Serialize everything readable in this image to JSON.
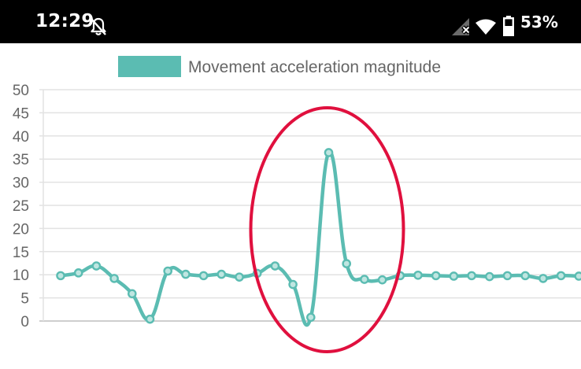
{
  "status_bar": {
    "time": "12:29",
    "battery": "53%",
    "icons": [
      "notifications-off-icon",
      "cellular-no-data-icon",
      "wifi-icon",
      "battery-icon"
    ]
  },
  "chart_data": {
    "type": "line",
    "title": "",
    "xlabel": "",
    "ylabel": "",
    "ylim": [
      0,
      50
    ],
    "y_ticks": [
      "0",
      "5",
      "10",
      "15",
      "20",
      "25",
      "30",
      "35",
      "40",
      "45",
      "50"
    ],
    "grid": true,
    "legend_position": "top",
    "series": [
      {
        "name": "Movement acceleration magnitude",
        "color": "#5bbcb2",
        "values": [
          9.8,
          10.4,
          11.9,
          9.2,
          5.9,
          0.4,
          10.8,
          10.1,
          9.8,
          10.1,
          9.5,
          10.3,
          11.9,
          7.9,
          0.8,
          36.4,
          12.4,
          9.0,
          8.9,
          9.8,
          9.9,
          9.8,
          9.7,
          9.8,
          9.6,
          9.8,
          9.8,
          9.2,
          9.8,
          9.7
        ]
      }
    ],
    "annotation": {
      "shape": "ellipse",
      "color": "#e0103e",
      "around_points": [
        13,
        17
      ]
    }
  }
}
